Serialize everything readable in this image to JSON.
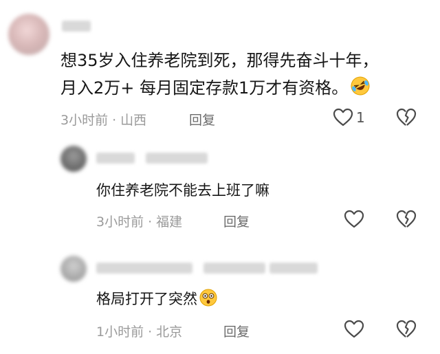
{
  "comments": [
    {
      "text_line1": "想35岁入住养老院到死，那得先奋斗十年，",
      "text_line2": "月入2万+ 每月固定存款1万才有资格。",
      "time": "3小时前",
      "location": "山西",
      "reply_label": "回复",
      "like_count": "1",
      "emoji": "rolling-on-floor-laughing-emoji"
    },
    {
      "text": "你住养老院不能去上班了嘛",
      "time": "3小时前",
      "location": "福建",
      "reply_label": "回复"
    },
    {
      "text": "格局打开了突然",
      "time": "1小时前",
      "location": "北京",
      "reply_label": "回复",
      "emoji": "hushed-face-emoji"
    }
  ],
  "separator": "·",
  "colors": {
    "text": "#161616",
    "meta": "#9a9a9a",
    "reply": "#6b6b6b",
    "icon": "#4a4a4a",
    "background": "#ffffff"
  }
}
